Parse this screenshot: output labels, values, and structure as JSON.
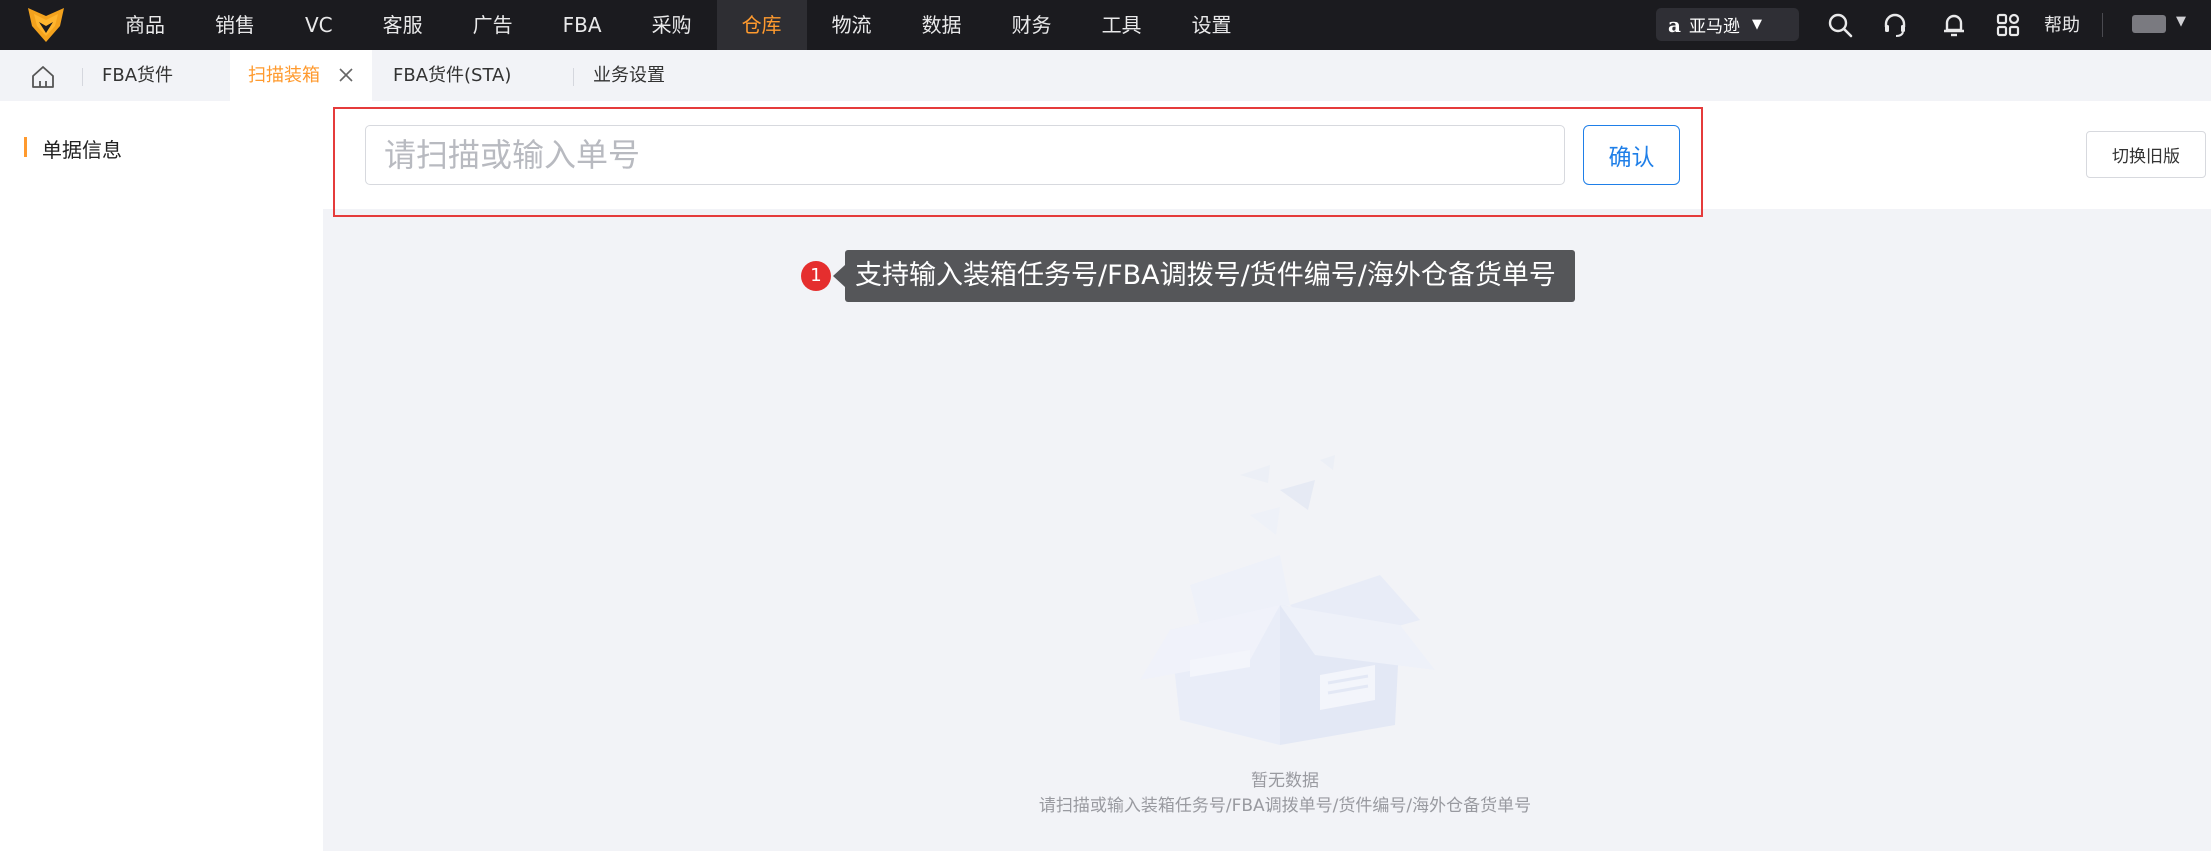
{
  "nav": {
    "items": [
      "商品",
      "销售",
      "VC",
      "客服",
      "广告",
      "FBA",
      "采购",
      "仓库",
      "物流",
      "数据",
      "财务",
      "工具",
      "设置"
    ],
    "active_index": 7,
    "marketplace": "亚马逊",
    "help": "帮助",
    "accent": "#ff9a2e"
  },
  "tabs": {
    "items": [
      "FBA货件",
      "扫描装箱",
      "FBA货件(STA)",
      "业务设置"
    ],
    "active": "扫描装箱"
  },
  "sidebar": {
    "title": "单据信息"
  },
  "scan": {
    "placeholder": "请扫描或输入单号",
    "confirm_label": "确认",
    "switch_label": "切换旧版"
  },
  "annotation": {
    "marker": "1",
    "text": "支持输入装箱任务号/FBA调拨号/货件编号/海外仓备货单号"
  },
  "empty": {
    "title": "暂无数据",
    "description": "请扫描或输入装箱任务号/FBA调拨单号/货件编号/海外仓备货单号"
  },
  "icons": [
    "logo-icon",
    "search-icon",
    "headset-icon",
    "bell-icon",
    "apps-grid-icon",
    "home-icon",
    "close-icon",
    "empty-box-icon"
  ]
}
